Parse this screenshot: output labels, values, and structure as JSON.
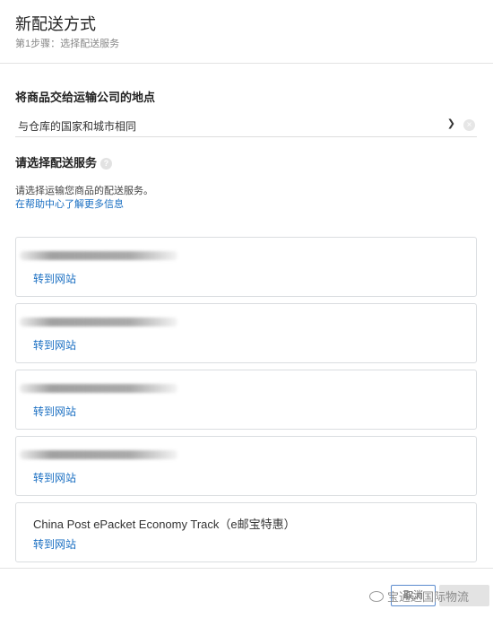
{
  "header": {
    "title": "新配送方式",
    "subtitle": "第1步骤：选择配送服务"
  },
  "handover": {
    "label": "将商品交给运输公司的地点",
    "value": "与仓库的国家和城市相同"
  },
  "service": {
    "label": "请选择配送服务",
    "description": "请选择运输您商品的配送服务。",
    "help_link": "在帮助中心了解更多信息"
  },
  "cards": [
    {
      "name": "",
      "link": "转到网站",
      "redacted": true
    },
    {
      "name": "",
      "link": "转到网站",
      "redacted": true
    },
    {
      "name": "",
      "link": "转到网站",
      "redacted": true
    },
    {
      "name": "",
      "link": "转到网站",
      "redacted": true
    },
    {
      "name": "China Post ePacket Economy Track（e邮宝特惠）",
      "link": "转到网站",
      "redacted": false
    }
  ],
  "footer": {
    "cancel_label": "取消",
    "save_label": "",
    "watermark": "宝通达国际物流"
  },
  "icons": {
    "dropdown": "chevron-down-icon",
    "clear": "clear-icon",
    "help": "help-icon",
    "watermark": "wechat-icon"
  },
  "colors": {
    "link": "#1a6fc2",
    "divider": "#e3e3e3"
  }
}
